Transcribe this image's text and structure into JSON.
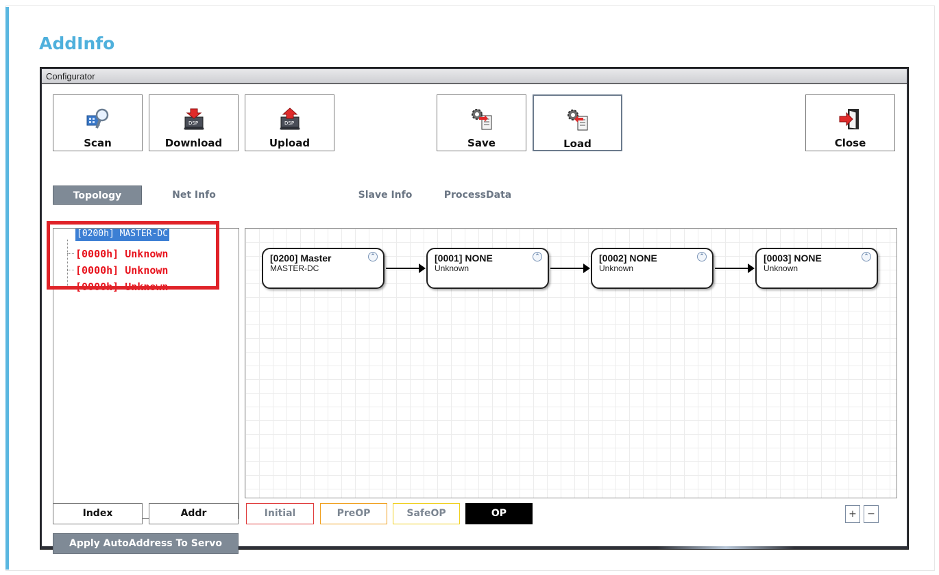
{
  "page": {
    "heading": "AddInfo"
  },
  "window": {
    "title": "Configurator"
  },
  "toolbar": [
    {
      "label": "Scan",
      "icon": "scan-icon"
    },
    {
      "label": "Download",
      "icon": "download-icon"
    },
    {
      "label": "Upload",
      "icon": "upload-icon"
    },
    {
      "label": "Save",
      "icon": "save-icon"
    },
    {
      "label": "Load",
      "icon": "load-icon"
    },
    {
      "label": "Close",
      "icon": "close-door-icon"
    }
  ],
  "tabs": [
    "Topology",
    "Net Info",
    "Slave Info",
    "ProcessData"
  ],
  "tree": {
    "root": "[0200h] MASTER-DC",
    "children": [
      "[0000h] Unknown",
      "[0000h] Unknown",
      "[0000h] Unknown"
    ]
  },
  "devices": [
    {
      "title": "[0200] Master",
      "sub": "MASTER-DC"
    },
    {
      "title": "[0001] NONE",
      "sub": "Unknown"
    },
    {
      "title": "[0002] NONE",
      "sub": "Unknown"
    },
    {
      "title": "[0003] NONE",
      "sub": "Unknown"
    }
  ],
  "bottom": {
    "index": "Index",
    "addr": "Addr",
    "states": [
      {
        "label": "Initial",
        "color": "#e03c3c"
      },
      {
        "label": "PreOP",
        "color": "#f0a020"
      },
      {
        "label": "SafeOP",
        "color": "#f0d020"
      },
      {
        "label": "OP",
        "color": "#000000"
      }
    ],
    "zoom_in": "+",
    "zoom_out": "−",
    "apply": "Apply AutoAddress To Servo"
  },
  "colors": {
    "accent": "#4fb0dc",
    "tab_selected": "#7f8a96",
    "error_text": "#e8141e",
    "highlight": "#e02228"
  }
}
